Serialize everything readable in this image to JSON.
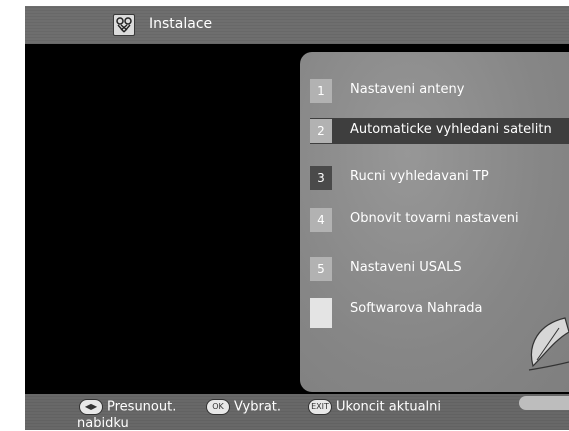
{
  "header": {
    "title": "Instalace",
    "icon": "tools-icon"
  },
  "menu": {
    "items": [
      {
        "number": "1",
        "label": "Nastaveni anteny"
      },
      {
        "number": "2",
        "label": "Automaticke vyhledani satelitn"
      },
      {
        "number": "3",
        "label": "Rucni vyhledavani TP"
      },
      {
        "number": "4",
        "label": "Obnovit tovarni nastaveni"
      },
      {
        "number": "5",
        "label": "Nastaveni USALS"
      },
      {
        "number": "",
        "label": "Softwarova Nahrada"
      }
    ],
    "selected_index": 1
  },
  "footer": {
    "move_label": "Presunout.",
    "ok_icon_text": "OK",
    "select_label": "Vybrat.",
    "exit_icon_text": "EXIT",
    "exit_label": "Ukoncit aktualni",
    "exit_label_line2": "nabidku"
  },
  "colors": {
    "title_bar": "#6e6e6e",
    "screen": "#000000",
    "panel": "#8a8a8a",
    "selected_row": "#3e3e3e"
  }
}
